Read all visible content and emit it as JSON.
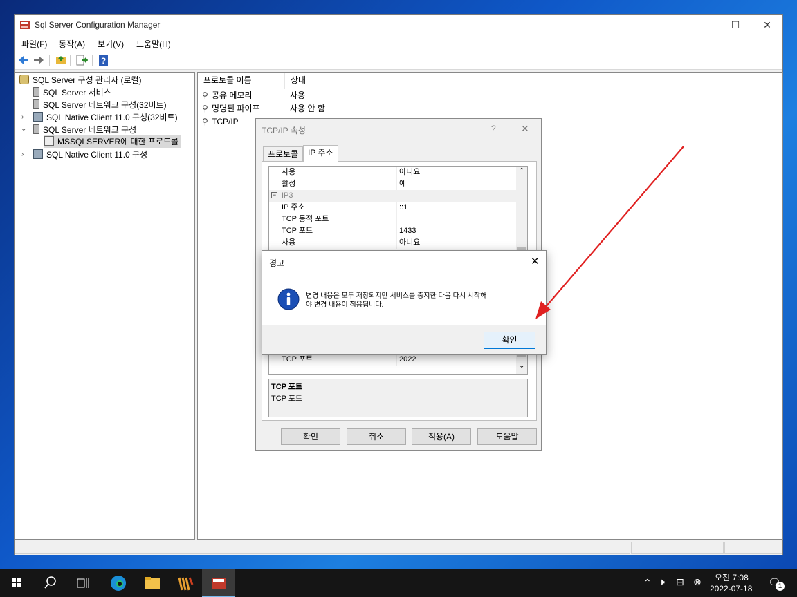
{
  "window": {
    "title": "Sql Server Configuration Manager"
  },
  "menu": [
    "파일(F)",
    "동작(A)",
    "보기(V)",
    "도움말(H)"
  ],
  "tree": {
    "root": "SQL Server 구성 관리자 (로컬)",
    "items": [
      "SQL Server 서비스",
      "SQL Server 네트워크 구성(32비트)",
      "SQL Native Client 11.0 구성(32비트)",
      "SQL Server 네트워크 구성",
      "MSSQLSERVER에 대한 프로토콜",
      "SQL Native Client 11.0 구성"
    ]
  },
  "list": {
    "columns": [
      "프로토콜 이름",
      "상태"
    ],
    "rows": [
      {
        "name": "공유 메모리",
        "status": "사용"
      },
      {
        "name": "명명된 파이프",
        "status": "사용 안 함"
      },
      {
        "name": "TCP/IP",
        "status": ""
      }
    ]
  },
  "tcp_dialog": {
    "title": "TCP/IP 속성",
    "help_glyph": "?",
    "tabs": [
      "프로토콜",
      "IP 주소"
    ],
    "grid": [
      {
        "key": "사용",
        "value": "아니요"
      },
      {
        "key": "활성",
        "value": "예"
      },
      {
        "section": "IP3"
      },
      {
        "key": "IP 주소",
        "value": "::1"
      },
      {
        "key": "TCP 동적 포트",
        "value": ""
      },
      {
        "key": "TCP 포트",
        "value": "1433"
      },
      {
        "key": "사용",
        "value": "아니요"
      }
    ],
    "last_row": {
      "key": "TCP 포트",
      "value": "2022"
    },
    "desc_title": "TCP 포트",
    "desc_text": "TCP 포트",
    "buttons": {
      "ok": "확인",
      "cancel": "취소",
      "apply": "적용(A)",
      "help": "도움말"
    }
  },
  "warning": {
    "title": "경고",
    "message_line1": "변경 내용은 모두 저장되지만 서비스를 중지한 다음 다시 시작해",
    "message_line2": "야 변경 내용이 적용됩니다.",
    "ok": "확인"
  },
  "taskbar": {
    "time": "오전 7:08",
    "date": "2022-07-18",
    "notification_count": "1"
  },
  "colors": {
    "accent": "#1a62d6",
    "arrow": "#e02020",
    "taskbar": "#151515"
  }
}
